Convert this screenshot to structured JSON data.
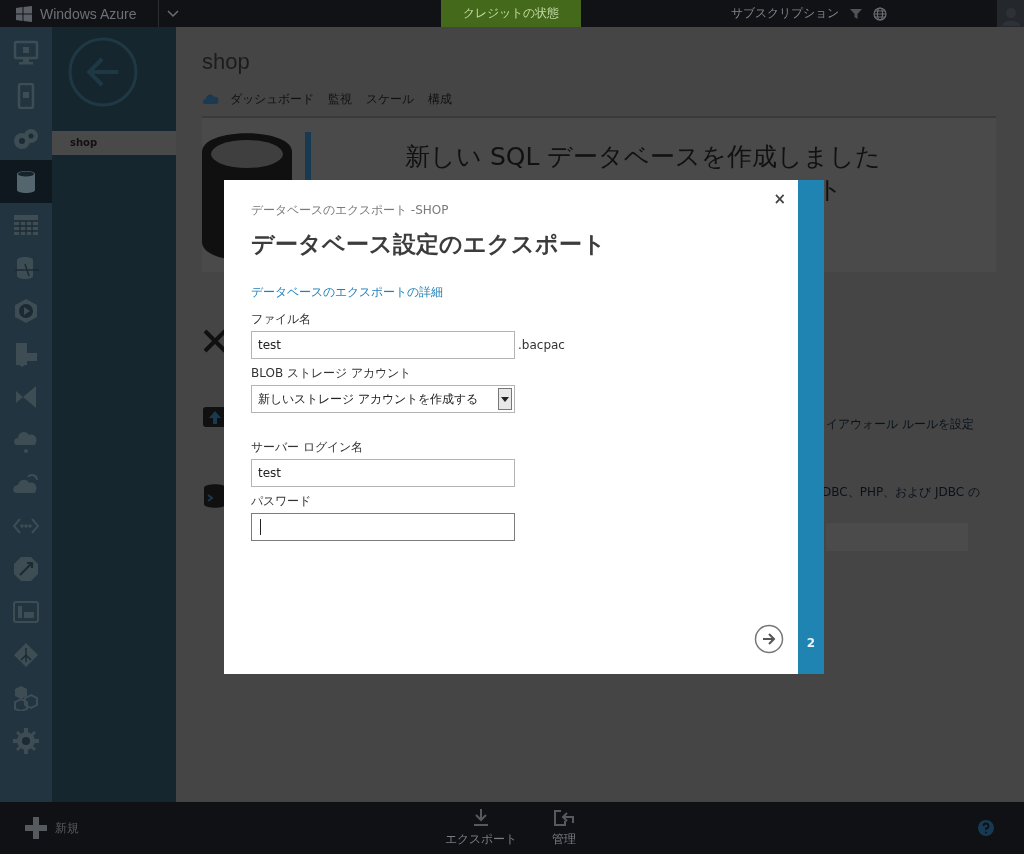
{
  "top_bar": {
    "brand": "Windows Azure",
    "credit_button": "クレジットの状態",
    "subscription": "サブスクリプション"
  },
  "rail": [
    {
      "kind": "monitor",
      "selected": false
    },
    {
      "kind": "phone",
      "selected": false
    },
    {
      "kind": "gears",
      "selected": false
    },
    {
      "kind": "database",
      "selected": true
    },
    {
      "kind": "table",
      "selected": false
    },
    {
      "kind": "sync",
      "selected": false
    },
    {
      "kind": "media",
      "selected": false
    },
    {
      "kind": "report",
      "selected": false
    },
    {
      "kind": "studio",
      "selected": false
    },
    {
      "kind": "hub",
      "selected": false
    },
    {
      "kind": "cloud",
      "selected": false
    },
    {
      "kind": "dots",
      "selected": false
    },
    {
      "kind": "arrows",
      "selected": false
    },
    {
      "kind": "panel",
      "selected": false
    },
    {
      "kind": "diamond",
      "selected": false
    },
    {
      "kind": "hexes",
      "selected": false
    },
    {
      "kind": "gear",
      "selected": false
    }
  ],
  "nav": {
    "items": [
      {
        "label": "shop",
        "selected": true
      }
    ]
  },
  "page": {
    "title": "shop",
    "tabs": [
      "ダッシュボード",
      "監視",
      "スケール",
      "構成"
    ],
    "banner_headline": "新しい SQL データベースを作成しました",
    "banner_fragment": "ト",
    "fragments": [
      "イアウォール ルールを設定",
      "DBC、PHP、および JDBC の"
    ]
  },
  "dialog": {
    "subtitle": "データベースのエクスポート -SHOP",
    "title": "データベース設定のエクスポート",
    "link": "データベースのエクスポートの詳細",
    "fields": [
      {
        "kind": "text",
        "label": "ファイル名",
        "value": "test",
        "suffix": ".bacpac",
        "focused": false
      },
      {
        "kind": "select",
        "label": "BLOB ストレージ アカウント",
        "value": "新しいストレージ アカウントを作成する",
        "focused": false
      },
      {
        "kind": "text",
        "label": "サーバー ログイン名",
        "value": "test",
        "focused": false
      },
      {
        "kind": "password",
        "label": "パスワード",
        "focused": true
      }
    ],
    "close": "×",
    "step": "2"
  },
  "bottom_bar": {
    "new_button": "新規",
    "actions": [
      {
        "kind": "download",
        "label": "エクスポート"
      },
      {
        "kind": "undo",
        "label": "管理"
      }
    ]
  }
}
